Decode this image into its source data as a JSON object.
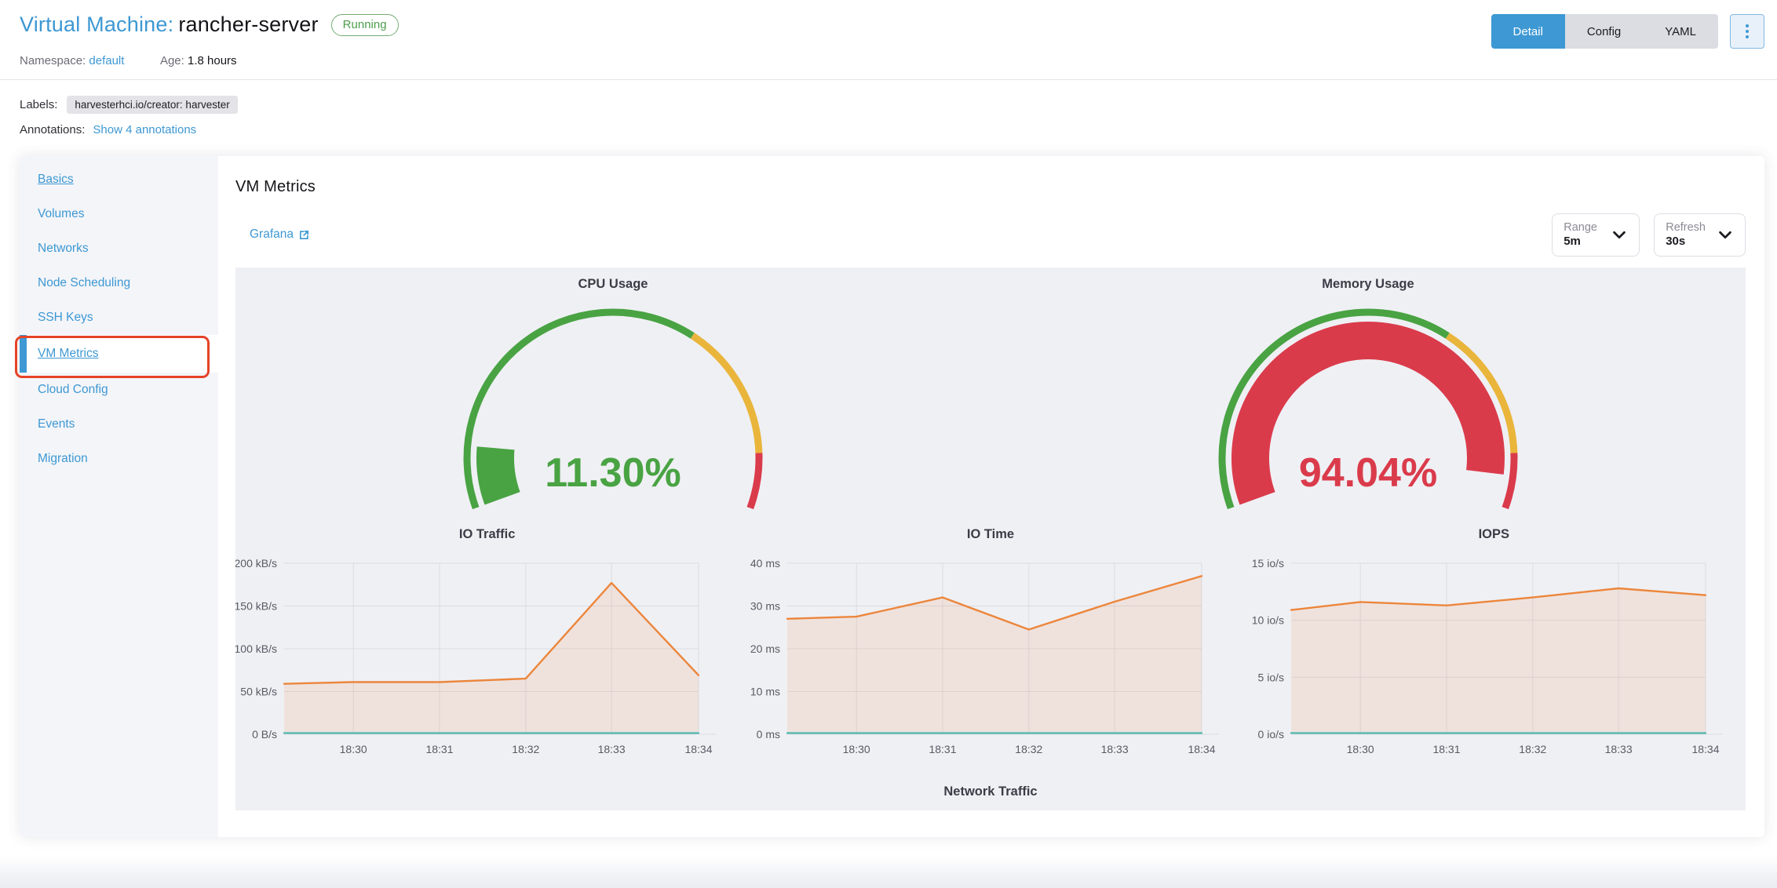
{
  "header": {
    "title_prefix": "Virtual Machine:",
    "vm_name": "rancher-server",
    "status_badge": "Running",
    "namespace_label": "Namespace:",
    "namespace_value": "default",
    "age_label": "Age:",
    "age_value": "1.8 hours",
    "tabs": {
      "detail": "Detail",
      "config": "Config",
      "yaml": "YAML"
    },
    "kebab_icon": "vertical-dots-menu",
    "labels_label": "Labels:",
    "label_badge": "harvesterhci.io/creator: harvester",
    "annotations_label": "Annotations:",
    "annotations_link": "Show 4 annotations"
  },
  "sidebar": {
    "items": [
      {
        "label": "Basics",
        "underlined": true
      },
      {
        "label": "Volumes"
      },
      {
        "label": "Networks"
      },
      {
        "label": "Node Scheduling"
      },
      {
        "label": "SSH Keys"
      },
      {
        "label": "VM Metrics",
        "active": true,
        "underlined": true,
        "highlighted": true
      },
      {
        "label": "Cloud Config"
      },
      {
        "label": "Events"
      },
      {
        "label": "Migration"
      }
    ]
  },
  "toolbar": {
    "heading": "VM Metrics",
    "grafana_label": "Grafana",
    "range_label": "Range",
    "range_value": "5m",
    "refresh_label": "Refresh",
    "refresh_value": "30s"
  },
  "colors": {
    "primary_blue": "#3D98D3",
    "gauge_green": "#49A343",
    "gauge_yellow": "#E9B53B",
    "gauge_red": "#DA3B4B",
    "line_orange": "#EC863C",
    "line_teal": "#5CBCB4",
    "grid": "#DBDCE2",
    "tick_text": "#565B63",
    "annotation_red": "#E54327"
  },
  "chart_data": [
    {
      "type": "gauge",
      "title": "CPU Usage",
      "value": 11.3,
      "display_value": "11.30%",
      "min": 0,
      "max": 100,
      "start_angle": 200,
      "end_angle": -20,
      "bands": [
        {
          "upto_fraction": 0.65,
          "color": "#49A343"
        },
        {
          "upto_fraction": 0.9,
          "color": "#E9B53B"
        },
        {
          "upto_fraction": 1.0,
          "color": "#DA3B4B"
        }
      ],
      "value_color": "#49A343"
    },
    {
      "type": "gauge",
      "title": "Memory Usage",
      "value": 94.04,
      "display_value": "94.04%",
      "min": 0,
      "max": 100,
      "start_angle": 200,
      "end_angle": -20,
      "bands": [
        {
          "upto_fraction": 0.65,
          "color": "#49A343"
        },
        {
          "upto_fraction": 0.9,
          "color": "#E9B53B"
        },
        {
          "upto_fraction": 1.0,
          "color": "#DA3B4B"
        }
      ],
      "value_color": "#DA3B4B"
    },
    {
      "type": "area",
      "title": "IO Traffic",
      "ymax": 200,
      "y_ticks": [
        {
          "label": "200 kB/s",
          "value": 200
        },
        {
          "label": "150 kB/s",
          "value": 150
        },
        {
          "label": "100 kB/s",
          "value": 100
        },
        {
          "label": "50 kB/s",
          "value": 50
        },
        {
          "label": "0 B/s",
          "value": 0
        }
      ],
      "x_ticks": [
        {
          "label": "18:30",
          "frac": 0.167
        },
        {
          "label": "18:31",
          "frac": 0.375
        },
        {
          "label": "18:32",
          "frac": 0.583
        },
        {
          "label": "18:33",
          "frac": 0.79
        },
        {
          "label": "18:34",
          "frac": 1.0
        }
      ],
      "series": [
        {
          "name": "series-1",
          "color": "#EC863C",
          "fill": true,
          "points": [
            [
              0,
              59
            ],
            [
              0.167,
              61
            ],
            [
              0.375,
              61
            ],
            [
              0.583,
              65
            ],
            [
              0.79,
              177
            ],
            [
              1.0,
              69
            ]
          ]
        },
        {
          "name": "series-2",
          "color": "#5CBCB4",
          "fill": false,
          "points": [
            [
              0,
              0
            ],
            [
              1.0,
              0
            ]
          ]
        }
      ]
    },
    {
      "type": "area",
      "title": "IO Time",
      "ymax": 40,
      "y_ticks": [
        {
          "label": "40 ms",
          "value": 40
        },
        {
          "label": "30 ms",
          "value": 30
        },
        {
          "label": "20 ms",
          "value": 20
        },
        {
          "label": "10 ms",
          "value": 10
        },
        {
          "label": "0 ms",
          "value": 0
        }
      ],
      "x_ticks": [
        {
          "label": "18:30",
          "frac": 0.167
        },
        {
          "label": "18:31",
          "frac": 0.375
        },
        {
          "label": "18:32",
          "frac": 0.583
        },
        {
          "label": "18:33",
          "frac": 0.79
        },
        {
          "label": "18:34",
          "frac": 1.0
        }
      ],
      "series": [
        {
          "name": "series-1",
          "color": "#EC863C",
          "fill": true,
          "points": [
            [
              0,
              27
            ],
            [
              0.167,
              27.5
            ],
            [
              0.375,
              32
            ],
            [
              0.583,
              24.5
            ],
            [
              0.79,
              31
            ],
            [
              1.0,
              37
            ]
          ]
        },
        {
          "name": "series-2",
          "color": "#5CBCB4",
          "fill": false,
          "points": [
            [
              0,
              0
            ],
            [
              1.0,
              0
            ]
          ]
        }
      ]
    },
    {
      "type": "area",
      "title": "IOPS",
      "ymax": 15,
      "y_ticks": [
        {
          "label": "15 io/s",
          "value": 15
        },
        {
          "label": "10 io/s",
          "value": 10
        },
        {
          "label": "5 io/s",
          "value": 5
        },
        {
          "label": "0 io/s",
          "value": 0
        }
      ],
      "x_ticks": [
        {
          "label": "18:30",
          "frac": 0.167
        },
        {
          "label": "18:31",
          "frac": 0.375
        },
        {
          "label": "18:32",
          "frac": 0.583
        },
        {
          "label": "18:33",
          "frac": 0.79
        },
        {
          "label": "18:34",
          "frac": 1.0
        }
      ],
      "series": [
        {
          "name": "series-1",
          "color": "#EC863C",
          "fill": true,
          "points": [
            [
              0,
              10.9
            ],
            [
              0.167,
              11.6
            ],
            [
              0.375,
              11.3
            ],
            [
              0.583,
              12.0
            ],
            [
              0.79,
              12.8
            ],
            [
              1.0,
              12.2
            ]
          ]
        },
        {
          "name": "series-2",
          "color": "#5CBCB4",
          "fill": false,
          "points": [
            [
              0,
              0
            ],
            [
              1.0,
              0
            ]
          ]
        }
      ]
    },
    {
      "type": "title-only",
      "title": "Network Traffic"
    }
  ]
}
